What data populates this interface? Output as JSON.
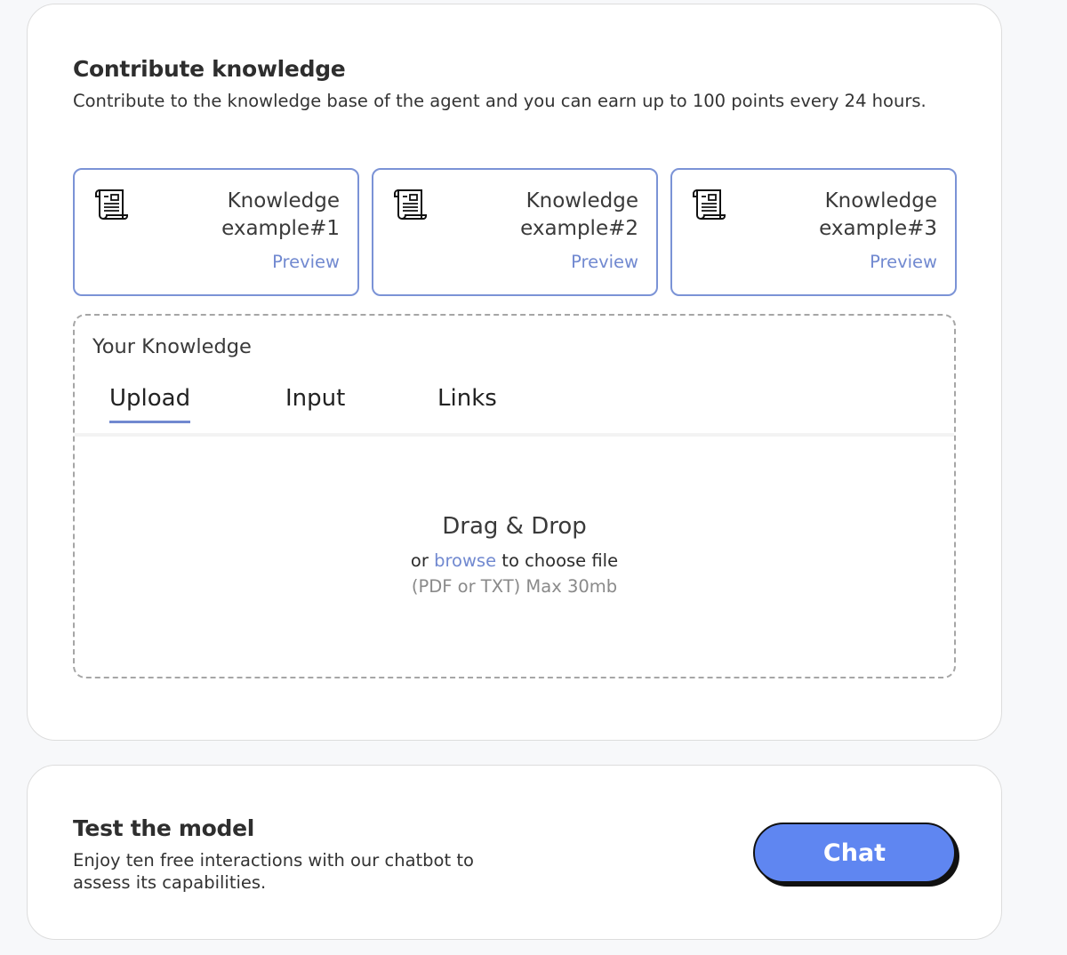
{
  "contribute": {
    "title": "Contribute knowledge",
    "description": "Contribute to the knowledge base of the agent and you can earn up to 100 points every 24 hours."
  },
  "examples": [
    {
      "title": "Knowledge example#1",
      "action": "Preview",
      "icon": "scroll-document-icon"
    },
    {
      "title": "Knowledge example#2",
      "action": "Preview",
      "icon": "scroll-document-icon"
    },
    {
      "title": "Knowledge example#3",
      "action": "Preview",
      "icon": "scroll-document-icon"
    }
  ],
  "your_knowledge": {
    "title": "Your Knowledge",
    "tabs": [
      {
        "label": "Upload",
        "active": true
      },
      {
        "label": "Input",
        "active": false
      },
      {
        "label": "Links",
        "active": false
      }
    ],
    "dropzone": {
      "title": "Drag & Drop",
      "prefix": "or",
      "browse": "browse",
      "suffix": "to choose file",
      "hint": "(PDF or TXT) Max 30mb"
    }
  },
  "test": {
    "title": "Test the model",
    "description": "Enjoy ten free interactions with our chatbot to assess its capabilities.",
    "chat_label": "Chat"
  },
  "colors": {
    "accent": "#7189d0",
    "button": "#5f86f1",
    "card_border": "#7b93d6"
  }
}
